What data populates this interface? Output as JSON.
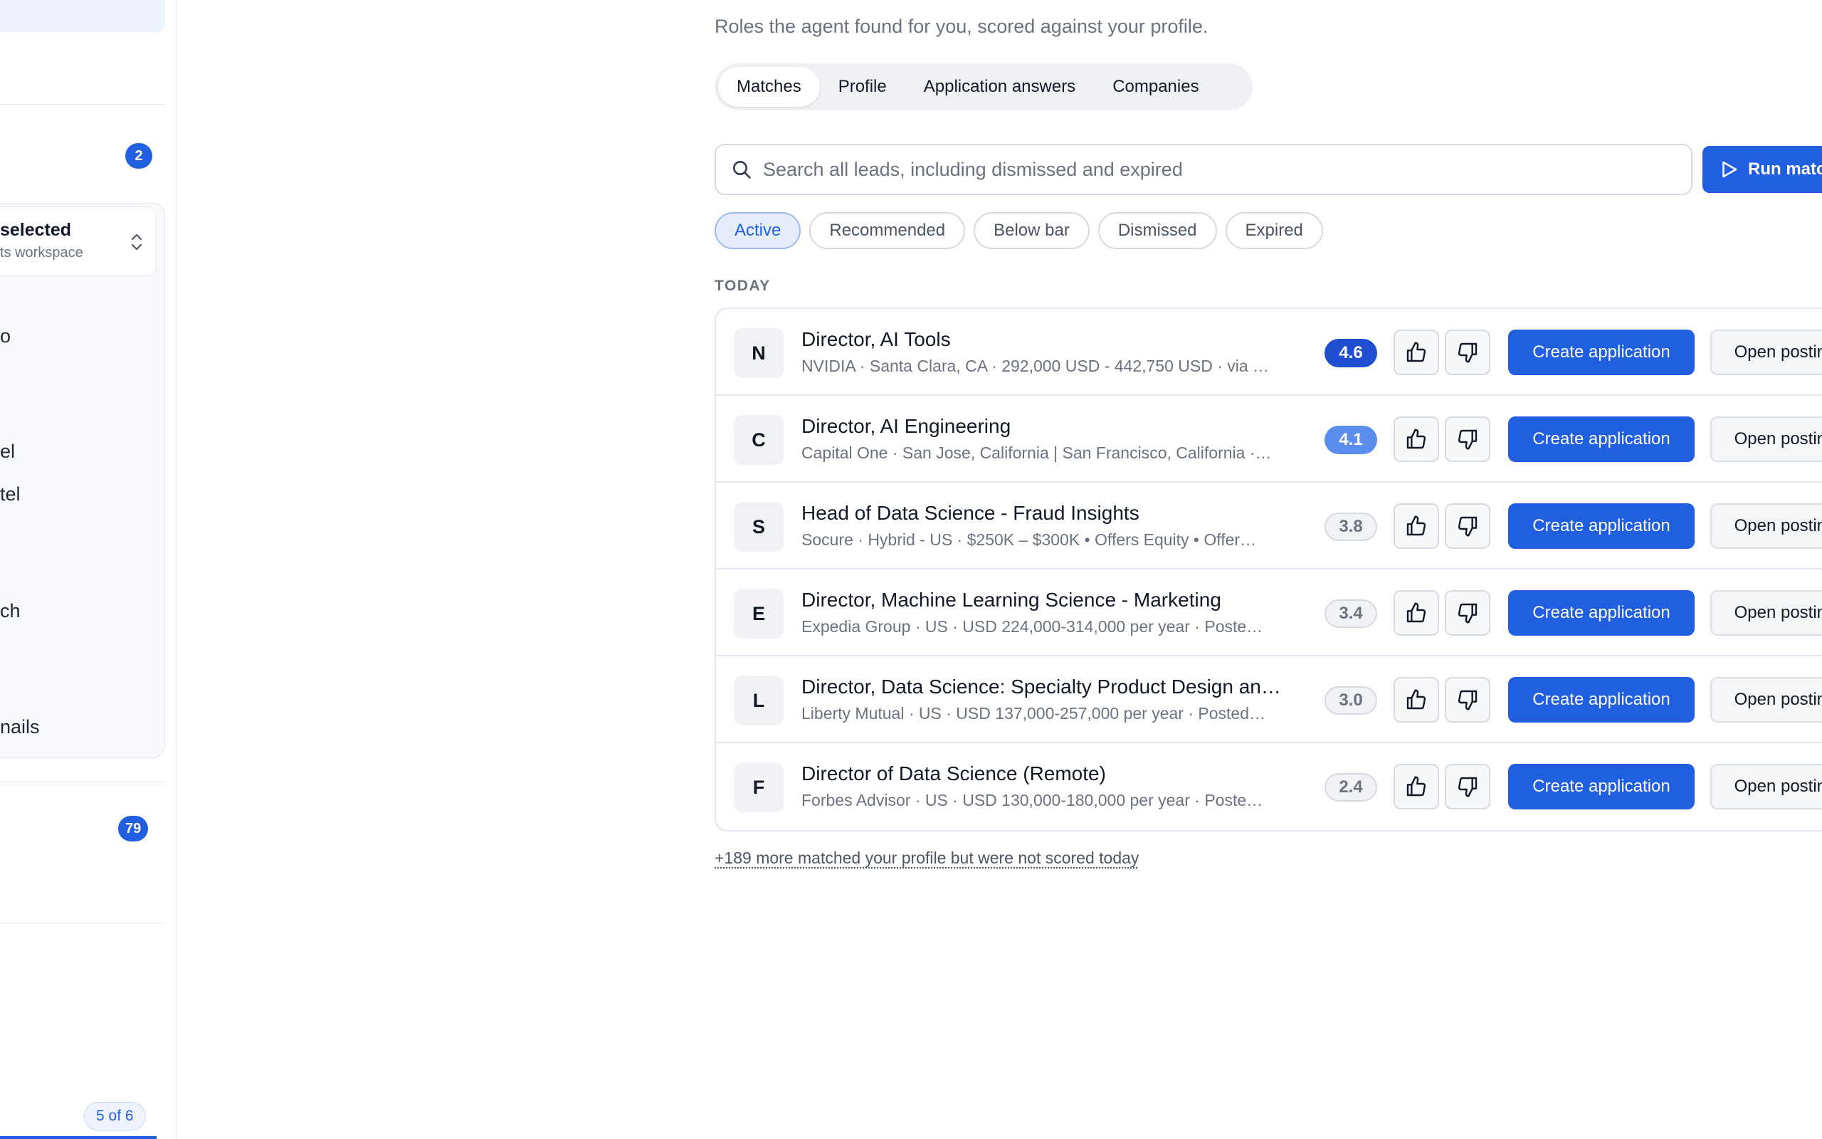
{
  "sidebar": {
    "badge_top": "2",
    "workspace_title": "selected",
    "workspace_sub": "ts workspace",
    "items": [
      "o",
      "el",
      "tel",
      "ch",
      "nails"
    ],
    "badge_bottom": "79",
    "pager": "5 of 6"
  },
  "main": {
    "subtitle": "Roles the agent found for you, scored against your profile.",
    "tabs": [
      {
        "label": "Matches",
        "active": true
      },
      {
        "label": "Profile",
        "active": false
      },
      {
        "label": "Application answers",
        "active": false
      },
      {
        "label": "Companies",
        "active": false
      }
    ],
    "search": {
      "placeholder": "Search all leads, including dismissed and expired",
      "value": ""
    },
    "run_button": "Run matching",
    "filters": [
      {
        "label": "Active",
        "active": true
      },
      {
        "label": "Recommended",
        "active": false
      },
      {
        "label": "Below bar",
        "active": false
      },
      {
        "label": "Dismissed",
        "active": false
      },
      {
        "label": "Expired",
        "active": false
      }
    ],
    "section_label": "TODAY",
    "jobs": [
      {
        "initial": "N",
        "title": "Director, AI Tools",
        "meta": "NVIDIA · Santa Clara, CA · 292,000 USD - 442,750 USD · via …",
        "score": "4.6",
        "score_level": "high",
        "create_label": "Create application",
        "open_label": "Open posting"
      },
      {
        "initial": "C",
        "title": "Director, AI Engineering",
        "meta": "Capital One · San Jose, California | San Francisco, California ·…",
        "score": "4.1",
        "score_level": "mid",
        "create_label": "Create application",
        "open_label": "Open posting"
      },
      {
        "initial": "S",
        "title": "Head of Data Science - Fraud Insights",
        "meta": "Socure · Hybrid - US · $250K – $300K • Offers Equity • Offer…",
        "score": "3.8",
        "score_level": "low",
        "create_label": "Create application",
        "open_label": "Open posting"
      },
      {
        "initial": "E",
        "title": "Director, Machine Learning Science - Marketing",
        "meta": "Expedia Group · US · USD 224,000-314,000 per year · Poste…",
        "score": "3.4",
        "score_level": "low",
        "create_label": "Create application",
        "open_label": "Open posting"
      },
      {
        "initial": "L",
        "title": "Director, Data Science: Specialty Product Design an…",
        "meta": "Liberty Mutual · US · USD 137,000-257,000 per year · Posted…",
        "score": "3.0",
        "score_level": "low",
        "create_label": "Create application",
        "open_label": "Open posting"
      },
      {
        "initial": "F",
        "title": "Director of Data Science (Remote)",
        "meta": "Forbes Advisor · US · USD 130,000-180,000 per year · Poste…",
        "score": "2.4",
        "score_level": "low",
        "create_label": "Create application",
        "open_label": "Open posting"
      }
    ],
    "more_link": "+189 more matched your profile but were not scored today"
  },
  "icons": {
    "search": "search-icon",
    "run": "play-icon",
    "thumbs_up": "thumbs-up-icon",
    "thumbs_down": "thumbs-down-icon",
    "workspace_switch": "chevron-up-down-icon"
  },
  "colors": {
    "accent": "#1f5fe0",
    "score_high": "#1f4fd0",
    "score_mid": "#5b8def"
  }
}
